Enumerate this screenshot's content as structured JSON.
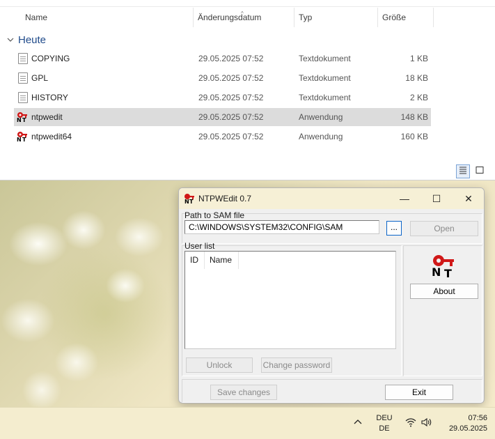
{
  "explorer": {
    "columns": {
      "name": "Name",
      "date": "Änderungsdatum",
      "type": "Typ",
      "size": "Größe"
    },
    "group": "Heute",
    "files": [
      {
        "name": "COPYING",
        "date": "29.05.2025 07:52",
        "type": "Textdokument",
        "size": "1 KB",
        "icon": "text-doc-icon",
        "selected": false
      },
      {
        "name": "GPL",
        "date": "29.05.2025 07:52",
        "type": "Textdokument",
        "size": "18 KB",
        "icon": "text-doc-icon",
        "selected": false
      },
      {
        "name": "HISTORY",
        "date": "29.05.2025 07:52",
        "type": "Textdokument",
        "size": "2 KB",
        "icon": "text-doc-icon",
        "selected": false
      },
      {
        "name": "ntpwedit",
        "date": "29.05.2025 07:52",
        "type": "Anwendung",
        "size": "148 KB",
        "icon": "ntpwedit-app-icon",
        "selected": true
      },
      {
        "name": "ntpwedit64",
        "date": "29.05.2025 07:52",
        "type": "Anwendung",
        "size": "160 KB",
        "icon": "ntpwedit-app-icon",
        "selected": false
      }
    ],
    "view_buttons": [
      "details-view-icon",
      "large-icons-view-icon"
    ]
  },
  "dialog": {
    "title": "NTPWEdit 0.7",
    "title_buttons": {
      "minimize": "—",
      "maximize": "☐",
      "close": "✕"
    },
    "path_label": "Path to SAM file",
    "path_value": "C:\\WINDOWS\\SYSTEM32\\CONFIG\\SAM",
    "browse_label": "...",
    "open_label": "Open",
    "userlist_label": "User list",
    "userlist_columns": [
      "ID",
      "Name"
    ],
    "unlock_label": "Unlock",
    "change_password_label": "Change password",
    "about_label": "About",
    "save_label": "Save changes",
    "exit_label": "Exit",
    "logo": "NT"
  },
  "taskbar": {
    "chevron": "^",
    "lang_top": "DEU",
    "lang_bottom": "DE",
    "time": "07:56",
    "date": "29.05.2025"
  },
  "colors": {
    "selected_row": "#dcdcdc",
    "group_heading": "#1f4a8a",
    "titlebar": "#f6f0d6",
    "taskbar": "#f4edcf"
  }
}
